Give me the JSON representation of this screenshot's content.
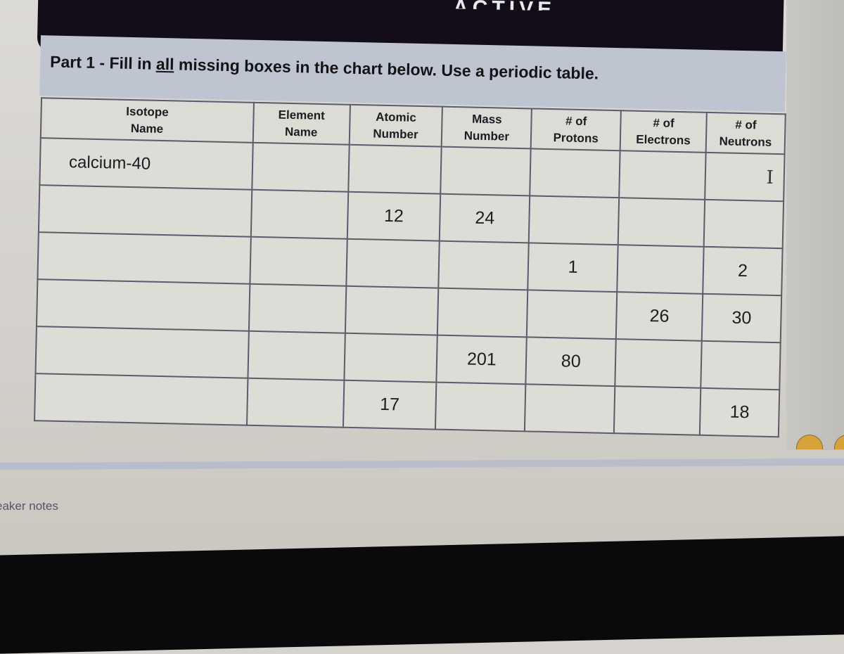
{
  "window": {
    "title_fragment": "ACTIVE",
    "speaker_notes_label": "eaker notes"
  },
  "slide": {
    "instruction_parts": {
      "before": "Part 1 - Fill in ",
      "emphasis": "all",
      "after": " missing boxes in the chart below. Use a periodic table."
    },
    "table": {
      "headers": [
        [
          "Isotope",
          "Name"
        ],
        [
          "Element",
          "Name"
        ],
        [
          "Atomic",
          "Number"
        ],
        [
          "Mass",
          "Number"
        ],
        [
          "# of",
          "Protons"
        ],
        [
          "# of",
          "Electrons"
        ],
        [
          "# of",
          "Neutrons"
        ]
      ],
      "rows": [
        [
          "calcium-40",
          "",
          "",
          "",
          "",
          "",
          ""
        ],
        [
          "",
          "",
          "12",
          "24",
          "",
          "",
          ""
        ],
        [
          "",
          "",
          "",
          "",
          "1",
          "",
          "2"
        ],
        [
          "",
          "",
          "",
          "",
          "",
          "26",
          "30"
        ],
        [
          "",
          "",
          "",
          "201",
          "80",
          "",
          ""
        ],
        [
          "",
          "",
          "17",
          "",
          "",
          "",
          "18"
        ]
      ]
    }
  },
  "icons": {
    "text_cursor": "I"
  }
}
